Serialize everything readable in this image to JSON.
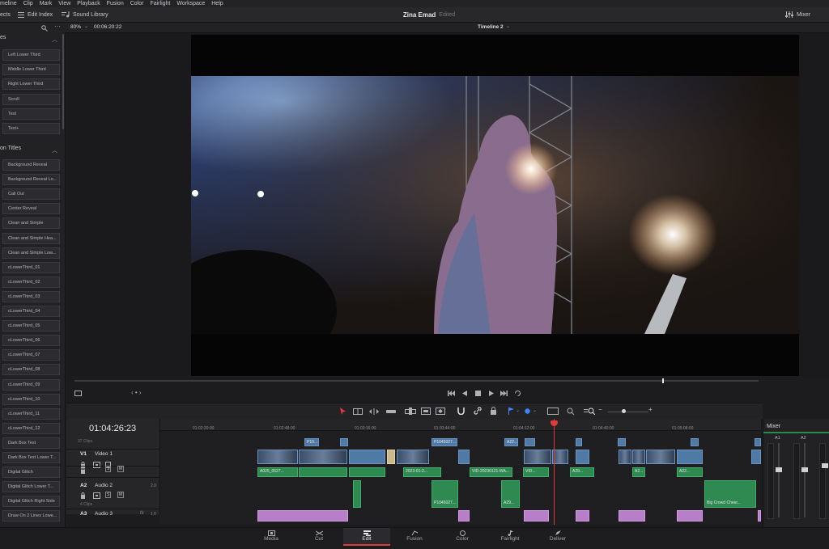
{
  "menu": [
    "meline",
    "Clip",
    "Mark",
    "View",
    "Playback",
    "Fusion",
    "Color",
    "Fairlight",
    "Workspace",
    "Help"
  ],
  "toolbar": {
    "effects": "ects",
    "edit_index": "Edit Index",
    "sound_library": "Sound Library",
    "mixer": "Mixer"
  },
  "project": {
    "title": "Zina Emad",
    "status": "Edited"
  },
  "viewer": {
    "zoom": "80%",
    "timecode": "00:06:20:22",
    "timeline_name": "Timeline 2"
  },
  "left_panel": {
    "section1": "es",
    "section1_items": [
      "Left Lower Third",
      "Middle Lower Third",
      "Right Lower Third",
      "Scroll",
      "Text",
      "Text+"
    ],
    "section2": "on Titles",
    "section2_items": [
      "Background Reveal",
      "Background Reveal Lo...",
      "Call Out",
      "Center Reveal",
      "Clean and Simple",
      "Clean and Simple Hea...",
      "Clean and Simple Low...",
      "cLowerThird_01",
      "cLowerThird_02",
      "cLowerThird_03",
      "cLowerThird_04",
      "cLowerThird_05",
      "cLowerThird_06",
      "cLowerThird_07",
      "cLowerThird_08",
      "cLowerThird_09",
      "cLowerThird_10",
      "cLowerThird_11",
      "cLowerThird_12",
      "Dark Box Text",
      "Dark Box Text Lower T...",
      "Digital Glitch",
      "Digital Glitch Lower T...",
      "Digital Glitch Right Side",
      "Draw On 2 Lines Lowe..."
    ]
  },
  "timeline": {
    "timecode": "01:04:26:23",
    "ruler": [
      "01:02:20:00",
      "01:02:48:00",
      "01:03:16:00",
      "01:03:44:00",
      "01:04:12:00",
      "01:04:40:00",
      "01:05:08:00"
    ],
    "tracks": [
      {
        "id": "V1",
        "name": "Video 1",
        "clips": "37 Clips"
      },
      {
        "id": "A2",
        "name": "Audio 2",
        "level": "2.0",
        "clips": "4 Clips"
      },
      {
        "id": "A3",
        "name": "Audio 3",
        "level": "1.0"
      }
    ],
    "clip_labels": {
      "v1": "P10...",
      "v2": "P1045027...",
      "v3": "A22...",
      "a1": "A025_0527...",
      "a2": "2023-01-2...",
      "a3": "VID-20230121-WA...",
      "a4": "VID...",
      "a5": "A29...",
      "a6": "A2...",
      "a7": "A22...",
      "b1": "P1045027...",
      "b2": "A29...",
      "b3": "Big Crowd Cheer..."
    }
  },
  "mixer": {
    "title": "Mixer",
    "channels": [
      "A1",
      "A2"
    ]
  },
  "pages": [
    "Media",
    "Cut",
    "Edit",
    "Fusion",
    "Color",
    "Fairlight",
    "Deliver"
  ],
  "active_page": "Edit",
  "colors": {
    "accent": "#e03b3b",
    "video_clip": "#4f7aa6",
    "audio_clip": "#2f8a52",
    "audio_clip_alt": "#b77ec9"
  }
}
